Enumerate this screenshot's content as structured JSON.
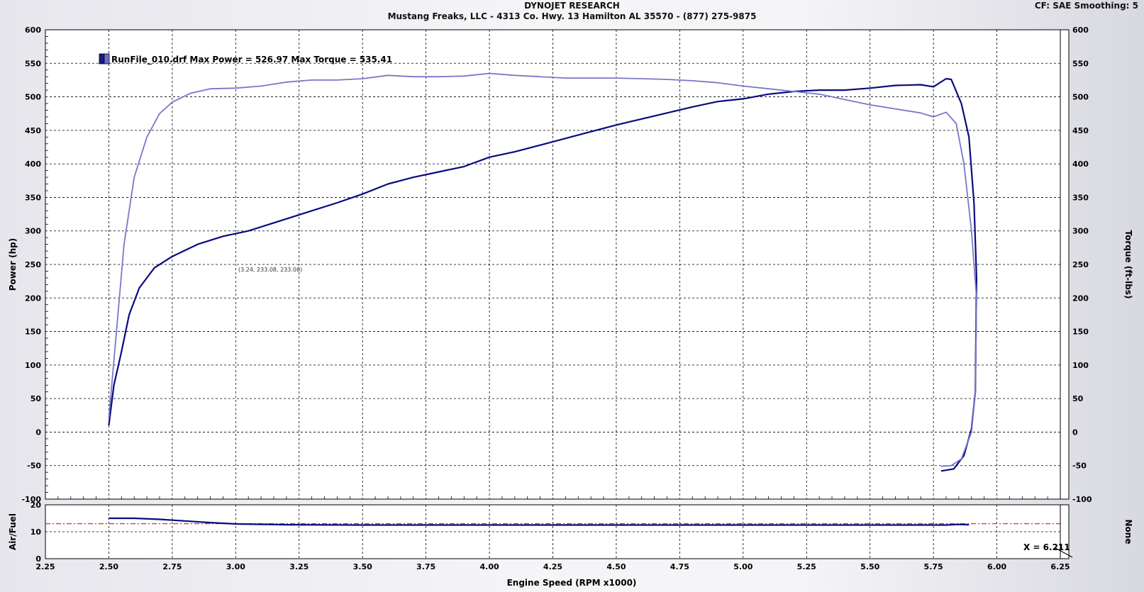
{
  "header": {
    "title": "DYNOJET RESEARCH",
    "subtitle": "Mustang Freaks, LLC - 4313 Co. Hwy. 13 Hamilton AL 35570 - (877) 275-9875",
    "correction": "CF: SAE  Smoothing: 5"
  },
  "legend": {
    "text": "RunFile_010.drf Max Power = 526.97 Max Torque = 535.41",
    "swatch_colors": [
      "#1a1a8c",
      "#6e6ec8"
    ]
  },
  "annotations": {
    "cursor_readout": "(3.24, 233.08, 233.08)",
    "x_marker": "X = 6.211"
  },
  "colors": {
    "power": "#0a0a80",
    "torque": "#7878c8",
    "airfuel": "#0a0a80",
    "target_line": "#ff2020",
    "grid": "#000000"
  },
  "chart_data": [
    {
      "type": "line",
      "title": "",
      "xlabel": "Engine Speed (RPM x1000)",
      "ylabel": "Power (hp)",
      "y2label": "Torque (ft-lbs)",
      "xlim": [
        2.25,
        6.25
      ],
      "ylim": [
        -100,
        600
      ],
      "y2lim": [
        -100,
        600
      ],
      "x_ticks": [
        "2.25",
        "2.50",
        "2.75",
        "3.00",
        "3.25",
        "3.50",
        "3.75",
        "4.00",
        "4.25",
        "4.50",
        "4.75",
        "5.00",
        "5.25",
        "5.50",
        "5.75",
        "6.00",
        "6.25"
      ],
      "y_ticks": [
        "-100",
        "-50",
        "0",
        "50",
        "100",
        "150",
        "200",
        "250",
        "300",
        "350",
        "400",
        "450",
        "500",
        "550",
        "600"
      ],
      "grid": true,
      "legend_position": "top-left",
      "series": [
        {
          "name": "Power",
          "axis": "left",
          "points": [
            [
              2.5,
              10
            ],
            [
              2.52,
              70
            ],
            [
              2.55,
              120
            ],
            [
              2.58,
              175
            ],
            [
              2.62,
              215
            ],
            [
              2.68,
              245
            ],
            [
              2.75,
              262
            ],
            [
              2.85,
              280
            ],
            [
              2.95,
              292
            ],
            [
              3.05,
              300
            ],
            [
              3.2,
              318
            ],
            [
              3.3,
              330
            ],
            [
              3.4,
              342
            ],
            [
              3.5,
              355
            ],
            [
              3.6,
              370
            ],
            [
              3.7,
              380
            ],
            [
              3.8,
              388
            ],
            [
              3.9,
              396
            ],
            [
              4.0,
              410
            ],
            [
              4.1,
              418
            ],
            [
              4.2,
              428
            ],
            [
              4.3,
              438
            ],
            [
              4.4,
              448
            ],
            [
              4.5,
              458
            ],
            [
              4.6,
              467
            ],
            [
              4.7,
              476
            ],
            [
              4.8,
              485
            ],
            [
              4.9,
              493
            ],
            [
              5.0,
              497
            ],
            [
              5.1,
              504
            ],
            [
              5.2,
              508
            ],
            [
              5.3,
              510
            ],
            [
              5.4,
              510
            ],
            [
              5.5,
              513
            ],
            [
              5.6,
              517
            ],
            [
              5.7,
              518
            ],
            [
              5.75,
              515
            ],
            [
              5.8,
              527
            ],
            [
              5.82,
              526
            ],
            [
              5.86,
              490
            ],
            [
              5.89,
              440
            ],
            [
              5.91,
              340
            ],
            [
              5.92,
              230
            ],
            [
              5.915,
              60
            ],
            [
              5.9,
              5
            ],
            [
              5.87,
              -35
            ],
            [
              5.83,
              -55
            ],
            [
              5.78,
              -58
            ]
          ]
        },
        {
          "name": "Torque",
          "axis": "right",
          "points": [
            [
              2.5,
              20
            ],
            [
              2.53,
              150
            ],
            [
              2.56,
              280
            ],
            [
              2.6,
              380
            ],
            [
              2.65,
              440
            ],
            [
              2.7,
              475
            ],
            [
              2.75,
              492
            ],
            [
              2.82,
              505
            ],
            [
              2.9,
              512
            ],
            [
              3.0,
              513
            ],
            [
              3.1,
              516
            ],
            [
              3.2,
              522
            ],
            [
              3.3,
              525
            ],
            [
              3.4,
              525
            ],
            [
              3.5,
              527
            ],
            [
              3.6,
              532
            ],
            [
              3.7,
              530
            ],
            [
              3.8,
              530
            ],
            [
              3.9,
              531
            ],
            [
              4.0,
              535
            ],
            [
              4.1,
              532
            ],
            [
              4.2,
              530
            ],
            [
              4.3,
              528
            ],
            [
              4.4,
              528
            ],
            [
              4.5,
              528
            ],
            [
              4.6,
              527
            ],
            [
              4.7,
              526
            ],
            [
              4.8,
              524
            ],
            [
              4.9,
              521
            ],
            [
              5.0,
              516
            ],
            [
              5.1,
              512
            ],
            [
              5.2,
              508
            ],
            [
              5.3,
              504
            ],
            [
              5.4,
              496
            ],
            [
              5.5,
              488
            ],
            [
              5.6,
              482
            ],
            [
              5.7,
              476
            ],
            [
              5.75,
              470
            ],
            [
              5.8,
              477
            ],
            [
              5.84,
              460
            ],
            [
              5.87,
              400
            ],
            [
              5.9,
              300
            ],
            [
              5.92,
              200
            ],
            [
              5.915,
              60
            ],
            [
              5.9,
              0
            ],
            [
              5.86,
              -40
            ],
            [
              5.82,
              -50
            ],
            [
              5.78,
              -51
            ]
          ]
        }
      ]
    },
    {
      "type": "line",
      "title": "",
      "ylabel": "Air/Fuel",
      "y2label": "None",
      "xlim": [
        2.25,
        6.25
      ],
      "ylim": [
        0,
        20
      ],
      "y_ticks": [
        "0",
        "10",
        "20"
      ],
      "grid": true,
      "target_value": 13.0,
      "series": [
        {
          "name": "Air/Fuel",
          "points": [
            [
              2.5,
              15.0
            ],
            [
              2.6,
              15.0
            ],
            [
              2.7,
              14.6
            ],
            [
              2.8,
              14.0
            ],
            [
              2.9,
              13.4
            ],
            [
              3.0,
              12.9
            ],
            [
              3.2,
              12.6
            ],
            [
              3.5,
              12.5
            ],
            [
              4.0,
              12.5
            ],
            [
              4.5,
              12.5
            ],
            [
              5.0,
              12.5
            ],
            [
              5.5,
              12.5
            ],
            [
              5.8,
              12.5
            ],
            [
              5.85,
              12.7
            ],
            [
              5.89,
              12.6
            ]
          ]
        }
      ]
    }
  ]
}
